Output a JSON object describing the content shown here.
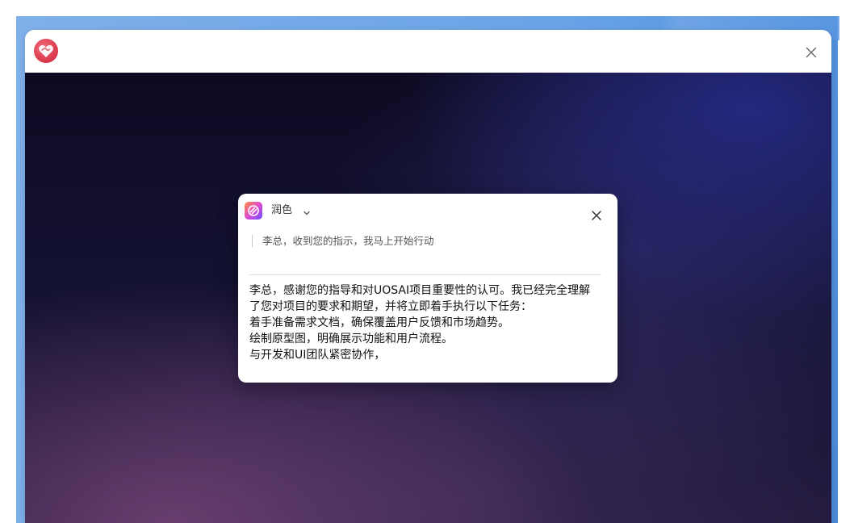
{
  "window": {
    "app_icon": "heart-handshake-icon",
    "close_icon": "close-icon"
  },
  "popup": {
    "mode_label": "润色",
    "mode_icon": "spiral-logo-icon",
    "chevron_icon": "chevron-down-icon",
    "close_icon": "close-icon",
    "source_text": "李总，收到您的指示，我马上开始行动",
    "result_lines": [
      "李总，感谢您的指导和对UOSAI项目重要性的认可。我已经完全理解",
      "了您对项目的要求和期望，并将立即着手执行以下任务：",
      "着手准备需求文档，确保覆盖用户反馈和市场趋势。",
      "绘制原型图，明确展示功能和用户流程。",
      "与开发和UI团队紧密协作，"
    ]
  },
  "colors": {
    "app_icon_red": "#d8364a",
    "dark_background": "#141233"
  }
}
